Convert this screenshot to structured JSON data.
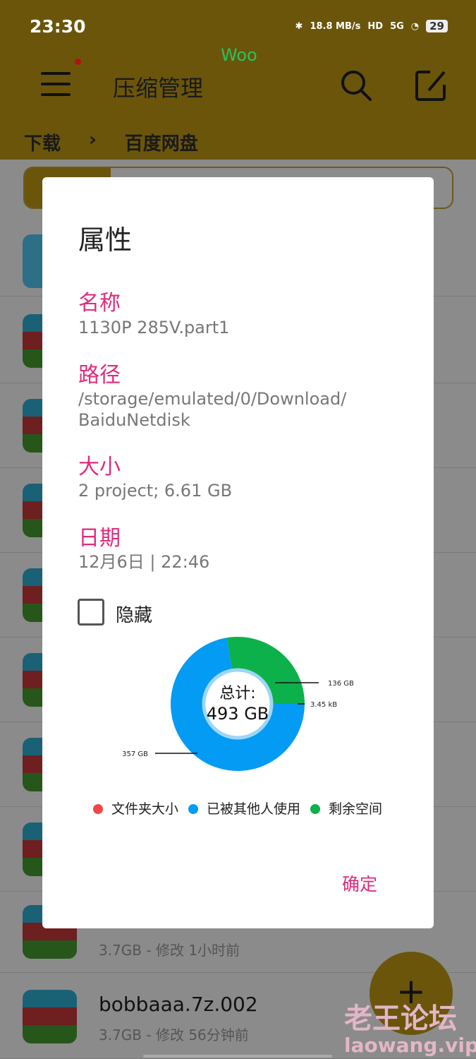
{
  "status": {
    "time": "23:30",
    "speed": "18.8 MB/s",
    "hd": "HD",
    "network": "5G",
    "battery": "29"
  },
  "overlay_text": "Woo",
  "appbar": {
    "title": "压缩管理",
    "breadcrumb": [
      "下载",
      "百度网盘"
    ]
  },
  "list": [
    {
      "size_meta": "3.7GB - 修改 1小时前"
    },
    {
      "name": "bobbaaa.7z.002",
      "size_meta": "3.7GB - 修改 56分钟前"
    }
  ],
  "watermark": {
    "line1": "老王论坛",
    "line2": "laowang.vip"
  },
  "dialog": {
    "title": "属性",
    "name_label": "名称",
    "name_value": "1130P 285V.part1",
    "path_label": "路径",
    "path_value": "/storage/emulated/0/Download/ BaiduNetdisk",
    "size_label": "大小",
    "size_value": "2 project; 6.61 GB",
    "date_label": "日期",
    "date_value": "12月6日 | 22:46",
    "hidden_label": "隐藏",
    "hidden_checked": false,
    "ok_label": "确定"
  },
  "chart_data": {
    "type": "pie",
    "center_label": "总计:",
    "center_value": "493 GB",
    "slices": [
      {
        "name": "剩余空间",
        "value_gb": 136,
        "label": "136 GB",
        "color": "#0db14b"
      },
      {
        "name": "文件夹大小",
        "value_gb": 3.45e-06,
        "label": "3.45 kB",
        "color": "#f04848"
      },
      {
        "name": "已被其他人使用",
        "value_gb": 357,
        "label": "357 GB",
        "color": "#039bf3"
      }
    ],
    "legend": [
      {
        "label": "文件夹大小",
        "color": "#f04848"
      },
      {
        "label": "已被其他人使用",
        "color": "#039bf3"
      },
      {
        "label": "剩余空间",
        "color": "#0db14b"
      }
    ],
    "legend_position": "bottom"
  }
}
